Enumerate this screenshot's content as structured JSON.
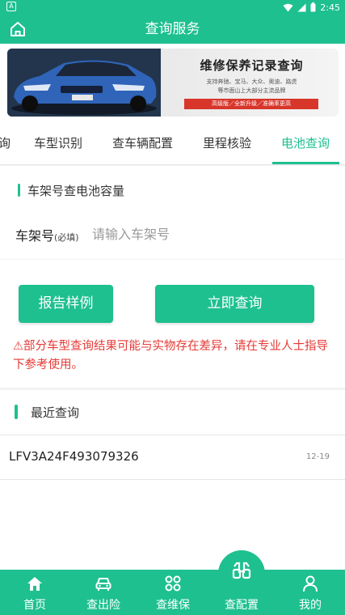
{
  "statusbar": {
    "app_badge": "A",
    "time": "2:45"
  },
  "header": {
    "title": "查询服务"
  },
  "banner": {
    "title": "维修保养记录查询",
    "line1": "支持奔驰、宝马、大众、奥迪、路虎",
    "line2": "等市面山上大部分主流品牌",
    "tag": "高级版／全新升级／准确率更高"
  },
  "tabs": [
    {
      "label": "询"
    },
    {
      "label": "车型识别"
    },
    {
      "label": "查车辆配置"
    },
    {
      "label": "里程核验"
    },
    {
      "label": "电池查询"
    }
  ],
  "form": {
    "section_title": "车架号查电池容量",
    "vin_label": "车架号",
    "vin_required": "(必填)",
    "vin_placeholder": "请输入车架号",
    "vin_value": ""
  },
  "buttons": {
    "sample": "报告样例",
    "query": "立即查询"
  },
  "warning": "⚠部分车型查询结果可能与实物存在差异，请在专业人士指导下参考使用。",
  "recent": {
    "title": "最近查询",
    "items": [
      {
        "vin": "LFV3A24F493079326",
        "date": "12-19"
      }
    ]
  },
  "nav": [
    {
      "label": "首页",
      "icon": "home-icon"
    },
    {
      "label": "查出险",
      "icon": "car-icon"
    },
    {
      "label": "查维保",
      "icon": "grid-icon"
    },
    {
      "label": "查配置",
      "icon": "binoculars-icon"
    },
    {
      "label": "我的",
      "icon": "user-icon"
    }
  ],
  "colors": {
    "accent": "#1ec08f",
    "warning": "#e53935"
  }
}
